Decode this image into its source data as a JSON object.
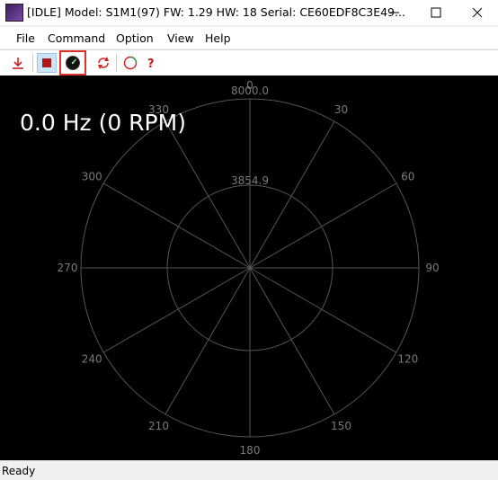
{
  "window": {
    "title": "[IDLE] Model: S1M1(97) FW: 1.29 HW: 18 Serial: CE60EDF8C3E49..."
  },
  "menu": [
    "File",
    "Command",
    "Option",
    "View",
    "Help"
  ],
  "toolbar": {
    "buttons": [
      "download-icon",
      "stop-icon",
      "gauge-icon",
      "refresh-icon",
      "circle-icon",
      "help-icon"
    ],
    "selected": "gauge-icon"
  },
  "display": {
    "frequency_readout": "0.0 Hz (0 RPM)",
    "outer_ring_value": "8000.0",
    "inner_ring_value": "3854.9",
    "angles": [
      "0",
      "30",
      "60",
      "90",
      "120",
      "150",
      "180",
      "210",
      "240",
      "270",
      "300",
      "330"
    ]
  },
  "status": {
    "text": "Ready"
  },
  "colors": {
    "canvas_bg": "#000000",
    "grid": "#555555",
    "readout": "#ffffff",
    "selection_border": "#e0302a"
  }
}
